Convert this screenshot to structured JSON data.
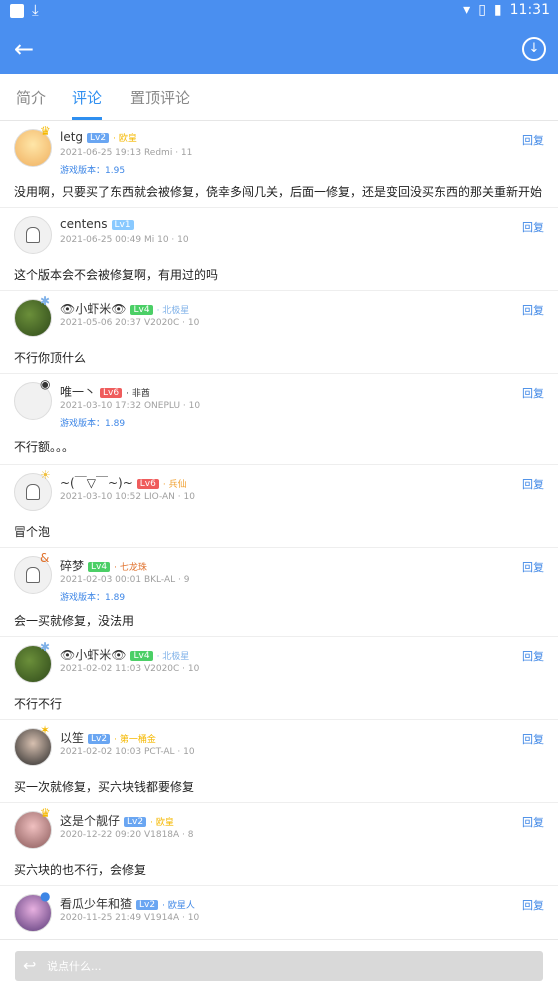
{
  "status": {
    "time": "11:31"
  },
  "tabs": [
    {
      "label": "简介"
    },
    {
      "label": "评论"
    },
    {
      "label": "置顶评论"
    }
  ],
  "reply_label": "回复",
  "comments": [
    {
      "name": "letg",
      "level": "Lv2",
      "honor": "欧皇",
      "honor_color": "#f5b800",
      "meta": "2021-06-25 19:13 Redmi · 11",
      "version": "游戏版本：1.95",
      "content": "没用啊，只要买了东西就会被修复，侥幸多闯几关，后面一修复，还是变回没买东西的那关重新开始"
    },
    {
      "name": "centens",
      "level": "Lv1",
      "honor": "",
      "honor_color": "",
      "meta": "2021-06-25 00:49 Mi 10 · 10",
      "version": "",
      "content": "这个版本会不会被修复啊，有用过的吗"
    },
    {
      "name": "👁小虾米👁",
      "level": "Lv4",
      "honor": "北极星",
      "honor_color": "#7fb1e8",
      "meta": "2021-05-06 20:37 V2020C · 10",
      "version": "",
      "content": "不行你顶什么"
    },
    {
      "name": "唯一丶",
      "level": "Lv6",
      "honor": "非酋",
      "honor_color": "#333333",
      "meta": "2021-03-10 17:32 ONEPLU · 10",
      "version": "游戏版本：1.89",
      "content": "不行额。。。"
    },
    {
      "name": "~(￣▽￣~)~",
      "level": "Lv6",
      "honor": "兵仙",
      "honor_color": "#f0a030",
      "meta": "2021-03-10 10:52 LIO-AN · 10",
      "version": "",
      "content": "冒个泡"
    },
    {
      "name": "碎梦",
      "level": "Lv4",
      "honor": "七龙珠",
      "honor_color": "#e0712c",
      "meta": "2021-02-03 00:01 BKL-AL · 9",
      "version": "游戏版本：1.89",
      "content": "会一买就修复，没法用"
    },
    {
      "name": "👁小虾米👁",
      "level": "Lv4",
      "honor": "北极星",
      "honor_color": "#7fb1e8",
      "meta": "2021-02-02 11:03 V2020C · 10",
      "version": "",
      "content": "不行不行"
    },
    {
      "name": "以笙",
      "level": "Lv2",
      "honor": "第一桶金",
      "honor_color": "#f5b800",
      "meta": "2021-02-02 10:03 PCT-AL · 10",
      "version": "",
      "content": "买一次就修复，买六块钱都要修复"
    },
    {
      "name": "这是个靓仔",
      "level": "Lv2",
      "honor": "欧皇",
      "honor_color": "#f5b800",
      "meta": "2020-12-22 09:20 V1818A · 8",
      "version": "",
      "content": "买六块的也不行，会修复"
    },
    {
      "name": "看瓜少年和猹",
      "level": "Lv2",
      "honor": "欧星人",
      "honor_color": "#3d86e6",
      "meta": "2020-11-25 21:49 V1914A · 10",
      "version": "",
      "content": ""
    }
  ],
  "input": {
    "placeholder": "说点什么..."
  }
}
